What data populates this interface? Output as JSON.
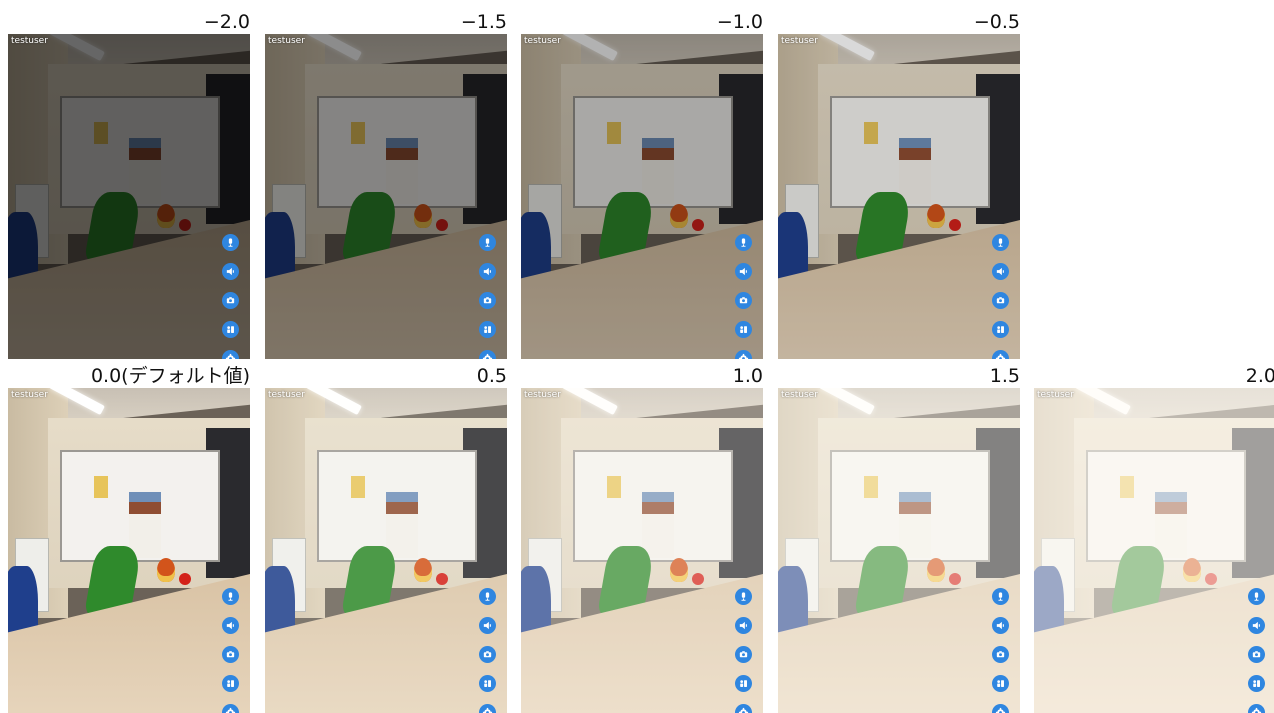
{
  "user_label": "testuser",
  "cells": [
    {
      "label": "−2.0",
      "exposure": -2.0
    },
    {
      "label": "−1.5",
      "exposure": -1.5
    },
    {
      "label": "−1.0",
      "exposure": -1.0
    },
    {
      "label": "−0.5",
      "exposure": -0.5
    },
    {
      "label": "0.0(デフォルト値)",
      "exposure": 0.0
    },
    {
      "label": "0.5",
      "exposure": 0.5
    },
    {
      "label": "1.0",
      "exposure": 1.0
    },
    {
      "label": "1.5",
      "exposure": 1.5
    },
    {
      "label": "2.0",
      "exposure": 2.0
    }
  ],
  "controls": [
    {
      "name": "mic-button",
      "icon": "mic-icon"
    },
    {
      "name": "speaker-button",
      "icon": "speaker-icon"
    },
    {
      "name": "switch-camera-button",
      "icon": "switch-camera-icon"
    },
    {
      "name": "participants-button",
      "icon": "participants-icon"
    },
    {
      "name": "settings-button",
      "icon": "gear-icon"
    }
  ],
  "colors": {
    "control_blue": "#2f86e0"
  }
}
